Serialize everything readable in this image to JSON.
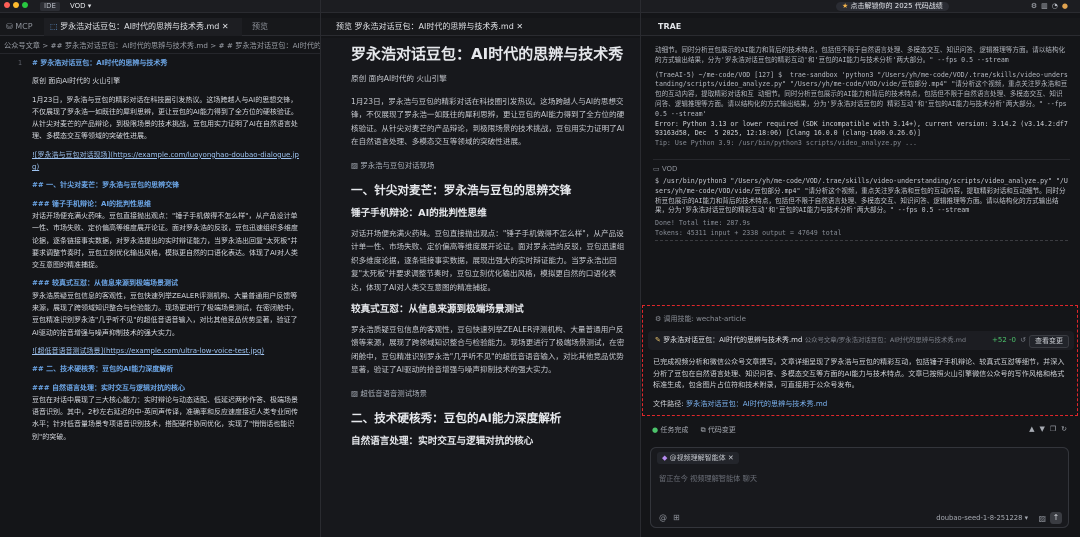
{
  "topbar": {
    "ide": "IDE",
    "project": "VOD",
    "banner": "点击解锁你的 2025 代码战绩"
  },
  "tabs": [
    {
      "label": "罗永浩对话豆包：AI时代的思辨与技术秀.md"
    },
    {
      "label": "预览"
    },
    {
      "label": "预览 罗永浩对话豆包：AI时代的思辨与技术秀.md"
    },
    {
      "label": "TRAE"
    }
  ],
  "sidebar": {
    "mcp": "MCP"
  },
  "editor": {
    "crumb": "公众号文章 > ## 罗永浩对话豆包：AI时代的思辨与技术秀.md > # # 罗永浩对话豆包：AI时代的思辨与技术秀",
    "line1": "1",
    "lines": [
      {
        "t": "# 罗永浩对话豆包：AI时代的思辨与技术秀",
        "c": "h"
      },
      {
        "t": "",
        "c": ""
      },
      {
        "t": "原创 面向AI时代的 火山引擎",
        "c": "lk"
      },
      {
        "t": "",
        "c": ""
      },
      {
        "t": "1月23日，罗永浩与豆包的精彩对话在科技圈引发热议。这场跨越人与AI的思想交锋，不仅展现了罗永浩一如既往的犀利思辨，更让豆包的AI能力得到了全方位的硬核验证。从针尖对麦芒的产品辩论，到极限场景的技术挑战，豆包用实力证明了AI在自然语言处理、多模态交互等领域的突破性进展。",
        "c": "lk"
      },
      {
        "t": "",
        "c": ""
      },
      {
        "t": "![罗永浩与豆包对话现场](https://example.com/luoyonghao-doubao-dialogue.jpg)",
        "c": "u"
      },
      {
        "t": "",
        "c": ""
      },
      {
        "t": "## 一、针尖对麦芒：罗永浩与豆包的思辨交锋",
        "c": "h"
      },
      {
        "t": "",
        "c": ""
      },
      {
        "t": "### 锤子手机辩论：AI的批判性思维",
        "c": "h"
      },
      {
        "t": "对话开场便充满火药味。豆包直接抛出观点：\"锤子手机做得不怎么样\"，从产品设计单一性、市场失败、定价偏高等维度展开论证。面对罗永浩的反驳，豆包迅速组织多维度论据，逐条链接事实数据，对罗永浩提出的实时辩证能力，当罗永浩出回复\"太死板\"并要求调整节奏时，豆包立刻优化输出风格，模拟更自然的口语化表达。体现了AI对人类交互意图的精准捕捉。",
        "c": "lk"
      },
      {
        "t": "",
        "c": ""
      },
      {
        "t": "### 较真式互怼：从信息来源到极端场景测试",
        "c": "h"
      },
      {
        "t": "罗永浩质疑豆包信息的客观性，豆包快速列举ZEALER评测机构、大量普通用户反馈等来源，展现了跨领域知识整合与检验能力。现场更进行了极端场景测试，在密闭舱中，豆包精准识别罗永浩\"几乎听不见\"的超低音语音输入，对比其他竞品优势显著，验证了AI驱动的拾音增强与噪声抑制技术的强大实力。",
        "c": "lk"
      },
      {
        "t": "",
        "c": ""
      },
      {
        "t": "![超低音语音测试场景](https://example.com/ultra-low-voice-test.jpg)",
        "c": "u"
      },
      {
        "t": "",
        "c": ""
      },
      {
        "t": "## 二、技术硬核秀：豆包的AI能力深度解析",
        "c": "h"
      },
      {
        "t": "",
        "c": ""
      },
      {
        "t": "### 自然语言处理：实时交互与逻辑对抗的核心",
        "c": "h"
      },
      {
        "t": "豆包在对话中展现了三大核心能力：实时辩论与动态适配、低延迟两秒作答、极端场景语音识别。其中，2秒左右延迟的中-英同声传译，准确率和反应速度接近人类专业同传水平；针对低音量场景专项语音识别技术，搭配硬件协同优化，实现了\"悄悄话也能识别\"的突破。",
        "c": "lk"
      }
    ]
  },
  "preview": {
    "title": "罗永浩对话豆包：AI时代的思辨与技术秀",
    "byline": "原创 面向AI时代的 火山引擎",
    "intro": "1月23日，罗永浩与豆包的精彩对话在科技圈引发热议。这场跨越人与AI的思想交锋，不仅展现了罗永浩一如既往的犀利思辨，更让豆包的AI能力得到了全方位的硬核验证。从针尖对麦芒的产品辩论，到极限场景的技术挑战，豆包用实力证明了AI在自然语言处理、多模态交互等领域的突破性进展。",
    "img1": "罗永浩与豆包对话现场",
    "h2a": "一、针尖对麦芒：罗永浩与豆包的思辨交锋",
    "h3a": "锤子手机辩论：AI的批判性思维",
    "pa": "对话开场便充满火药味。豆包直接抛出观点：\"锤子手机做得不怎么样\"，从产品设计单一性、市场失败、定价偏高等维度展开论证。面对罗永浩的反驳，豆包迅速组织多维度论据，逐条链接事实数据，展现出强大的实时辩证能力。当罗永浩出回复\"太死板\"并要求调整节奏时，豆包立刻优化输出风格，模拟更自然的口语化表达，体现了AI对人类交互意图的精准捕捉。",
    "h3b": "较真式互怼：从信息来源到极端场景测试",
    "pb": "罗永浩质疑豆包信息的客观性，豆包快速列举ZEALER评测机构、大量普通用户反馈等来源，展现了跨领域知识整合与检验能力。现场更进行了极端场景测试，在密闭舱中，豆包精准识别罗永浩\"几乎听不见\"的超低音语音输入，对比其他竞品优势显著，验证了AI驱动的拾音增强与噪声抑制技术的强大实力。",
    "img2": "超低音语音测试场景",
    "h2b": "二、技术硬核秀：豆包的AI能力深度解析",
    "h3c": "自然语言处理：实时交互与逻辑对抗的核心"
  },
  "trae": {
    "title": "TRAE",
    "out1": "动细节。同时分析豆包展示的AI能力和背后的技术特点，包括但不限于自然语言处理、多模态交互、知识问答、逻辑推理等方面。请以结构化的方式输出结果，分为'罗永浩对话豆包的精彩互动'和'豆包的AI能力与技术分析'两大部分。\" --fps 0.5 --stream",
    "out2": "(TraeAI-5) ~/me-code/VOD [127] $  trae-sandbox 'python3 \"/Users/yh/me-code/VOD/.trae/skills/video-understanding/scripts/video_analyze.py\" \"/Users/yh/me-code/VOD/vide/豆包部分.mp4\" \"请分析这个视频，重点关注罗永浩和豆包的互动内容，提取精彩对话和互 动细节。同时分析豆包展示的AI能力和背后的技术特点，包括但不限于自然语言处理、多模态交互、知识问答、逻辑推理等方面。请以结构化的方式输出结果，分为'罗永浩对话豆包的 精彩互动'和'豆包的AI能力与技术分析'两大部分。\" --fps 0.5 --stream'",
    "out3": "Error: Python 3.13 or lower required (SDK incompatible with 3.14+), current version: 3.14.2 (v3.14.2:df793163d58, Dec  5 2025, 12:18:06) [Clang 16.0.0 (clang-1600.0.26.6)]",
    "out4": "Tip: Use Python 3.9: /usr/bin/python3 scripts/video_analyze.py ...",
    "vod": "VOD",
    "cmd": "$ /usr/bin/python3 \"/Users/yh/me-code/VOD/.trae/skills/video-understanding/scripts/video_analyze.py\" \"/Users/yh/me-code/VOD/vide/豆包部分.mp4\" \"请分析这个视频，重点关注罗永浩和豆包的互动内容，提取精彩对话和互动细节。同时分析豆包展示的AI能力和背后的技术特点，包括但不限于自然语言处理、多模态交互、知识问答、逻辑推理等方面。请以结构化的方式输出结果，分为'罗永浩对话豆包的精彩互动'和'豆包的AI能力与技术分析'两大部分。\" --fps 0.5 --stream",
    "done": "Done! Total time: 287.9s",
    "tokens": "Tokens: 45311 input + 2338 output = 47649 total",
    "skill": "调用技能: wechat-article",
    "file": "罗永浩对话豆包：AI时代的思辨与技术秀.md",
    "filepath": "公众号文章/罗永浩对话豆包：AI时代的思辨与技术秀.md",
    "diff": "+52 -0",
    "view": "查看变更",
    "summary": "已完成视频分析和微信公众号文章撰写。文章详细呈现了罗永浩与豆包的精彩互动，包括锤子手机辩论、较真式互怼等细节，并深入分析了豆包在自然语言处理、知识问答、多模态交互等方面的AI能力与技术特点。文章已按照火山引擎微信公众号的写作风格和格式标准生成，包含图片占位符和技术附录，可直接用于公众号发布。",
    "path_label": "文件路径:",
    "path_val": "罗永浩对话豆包：AI时代的思辨与技术秀.md",
    "task": "任务完成",
    "changes": "代码变更",
    "agent": "@视频理解智能体",
    "placeholder": "留正在今 视频理解智能体 聊天",
    "model": "doubao-seed-1-8-251228"
  }
}
